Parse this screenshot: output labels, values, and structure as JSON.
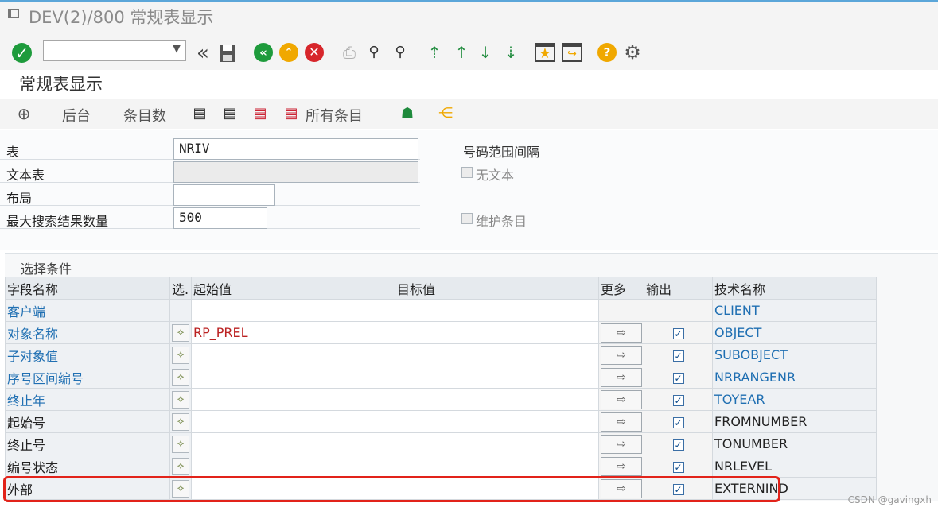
{
  "window": {
    "title": "DEV(2)/800 常规表显示"
  },
  "toolbar": {
    "command_field": ""
  },
  "app": {
    "title": "常规表显示"
  },
  "app_toolbar": {
    "backend": "后台",
    "entry_count": "条目数",
    "all_entries": "所有条目"
  },
  "fields": {
    "table_label": "表",
    "table_value": "NRIV",
    "text_table_label": "文本表",
    "text_table_value": "",
    "layout_label": "布局",
    "layout_value": "",
    "max_hits_label": "最大搜索结果数量",
    "max_hits_value": "500"
  },
  "right": {
    "title": "号码范围间隔",
    "no_text_label": "无文本",
    "no_text_checked": false,
    "maintain_label": "维护条目",
    "maintain_checked": false
  },
  "selection": {
    "group_title": "选择条件",
    "headers": [
      "字段名称",
      "选.",
      "起始值",
      "目标值",
      "更多",
      "输出",
      "技术名称"
    ],
    "rows": [
      {
        "field": "客户端",
        "from": "",
        "to": "",
        "tech": "CLIENT",
        "key": true,
        "has_select": false,
        "output": false
      },
      {
        "field": "对象名称",
        "from": "RP_PREL",
        "to": "",
        "tech": "OBJECT",
        "key": true,
        "has_select": true,
        "output": true
      },
      {
        "field": "子对象值",
        "from": "",
        "to": "",
        "tech": "SUBOBJECT",
        "key": true,
        "has_select": true,
        "output": true
      },
      {
        "field": "序号区间编号",
        "from": "",
        "to": "",
        "tech": "NRRANGENR",
        "key": true,
        "has_select": true,
        "output": true
      },
      {
        "field": "终止年",
        "from": "",
        "to": "",
        "tech": "TOYEAR",
        "key": true,
        "has_select": true,
        "output": true
      },
      {
        "field": "起始号",
        "from": "",
        "to": "",
        "tech": "FROMNUMBER",
        "key": false,
        "has_select": true,
        "output": true
      },
      {
        "field": "终止号",
        "from": "",
        "to": "",
        "tech": "TONUMBER",
        "key": false,
        "has_select": true,
        "output": true
      },
      {
        "field": "编号状态",
        "from": "",
        "to": "",
        "tech": "NRLEVEL",
        "key": false,
        "has_select": true,
        "output": true
      },
      {
        "field": "外部",
        "from": "",
        "to": "",
        "tech": "EXTERNIND",
        "key": false,
        "has_select": true,
        "output": true
      }
    ]
  },
  "watermark": "CSDN @gavingxh",
  "colors": {
    "accent": "#5ba6d9",
    "link": "#1f6fb2",
    "highlight": "#e2231a",
    "ok_green": "#1e9b3c",
    "cancel_red": "#d7262b",
    "nav_yellow": "#f0a800"
  }
}
